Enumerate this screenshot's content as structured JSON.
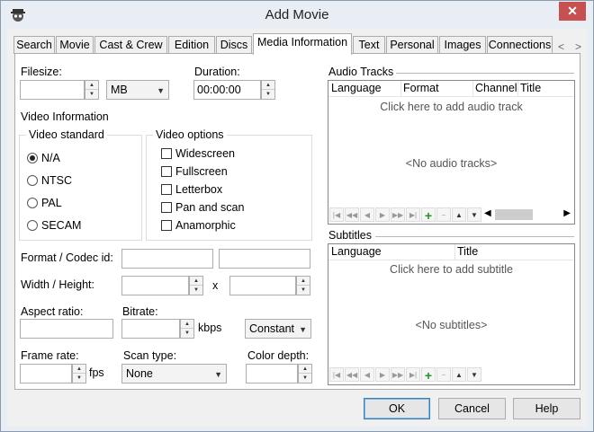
{
  "window": {
    "title": "Add Movie"
  },
  "tabs": [
    {
      "label": "Search"
    },
    {
      "label": "Movie"
    },
    {
      "label": "Cast & Crew"
    },
    {
      "label": "Edition"
    },
    {
      "label": "Discs"
    },
    {
      "label": "Media Information"
    },
    {
      "label": "Text"
    },
    {
      "label": "Personal"
    },
    {
      "label": "Images"
    },
    {
      "label": "Connections"
    }
  ],
  "filesize": {
    "label": "Filesize:",
    "value": "",
    "unit": "MB"
  },
  "duration": {
    "label": "Duration:",
    "value": "00:00:00"
  },
  "video_information": {
    "label": "Video Information"
  },
  "video_standard": {
    "title": "Video standard",
    "options": [
      "N/A",
      "NTSC",
      "PAL",
      "SECAM"
    ],
    "selected": "N/A"
  },
  "video_options": {
    "title": "Video options",
    "options": [
      "Widescreen",
      "Fullscreen",
      "Letterbox",
      "Pan and scan",
      "Anamorphic"
    ]
  },
  "format": {
    "label": "Format / Codec id:"
  },
  "width_height": {
    "label": "Width / Height:",
    "separator": "x"
  },
  "aspect": {
    "label": "Aspect ratio:"
  },
  "bitrate": {
    "label": "Bitrate:",
    "unit": "kbps",
    "mode": "Constant"
  },
  "frame_rate": {
    "label": "Frame rate:",
    "unit": "fps"
  },
  "scan_type": {
    "label": "Scan type:",
    "value": "None"
  },
  "color_depth": {
    "label": "Color depth:"
  },
  "audio": {
    "title": "Audio Tracks",
    "columns": [
      "Language",
      "Format",
      "Channel",
      "Title"
    ],
    "add_hint": "Click here to add audio track",
    "empty": "<No audio tracks>"
  },
  "subtitles": {
    "title": "Subtitles",
    "columns": [
      "Language",
      "Title"
    ],
    "add_hint": "Click here to add subtitle",
    "empty": "<No subtitles>"
  },
  "buttons": {
    "ok": "OK",
    "cancel": "Cancel",
    "help": "Help"
  },
  "nav_icons": [
    "first-icon",
    "prev-page-icon",
    "prev-icon",
    "next-icon",
    "next-page-icon",
    "last-icon",
    "add-icon",
    "remove-icon",
    "move-up-icon",
    "move-down-icon"
  ],
  "colors": {
    "add_green": "#1a9a1a",
    "close_red": "#c75050"
  }
}
